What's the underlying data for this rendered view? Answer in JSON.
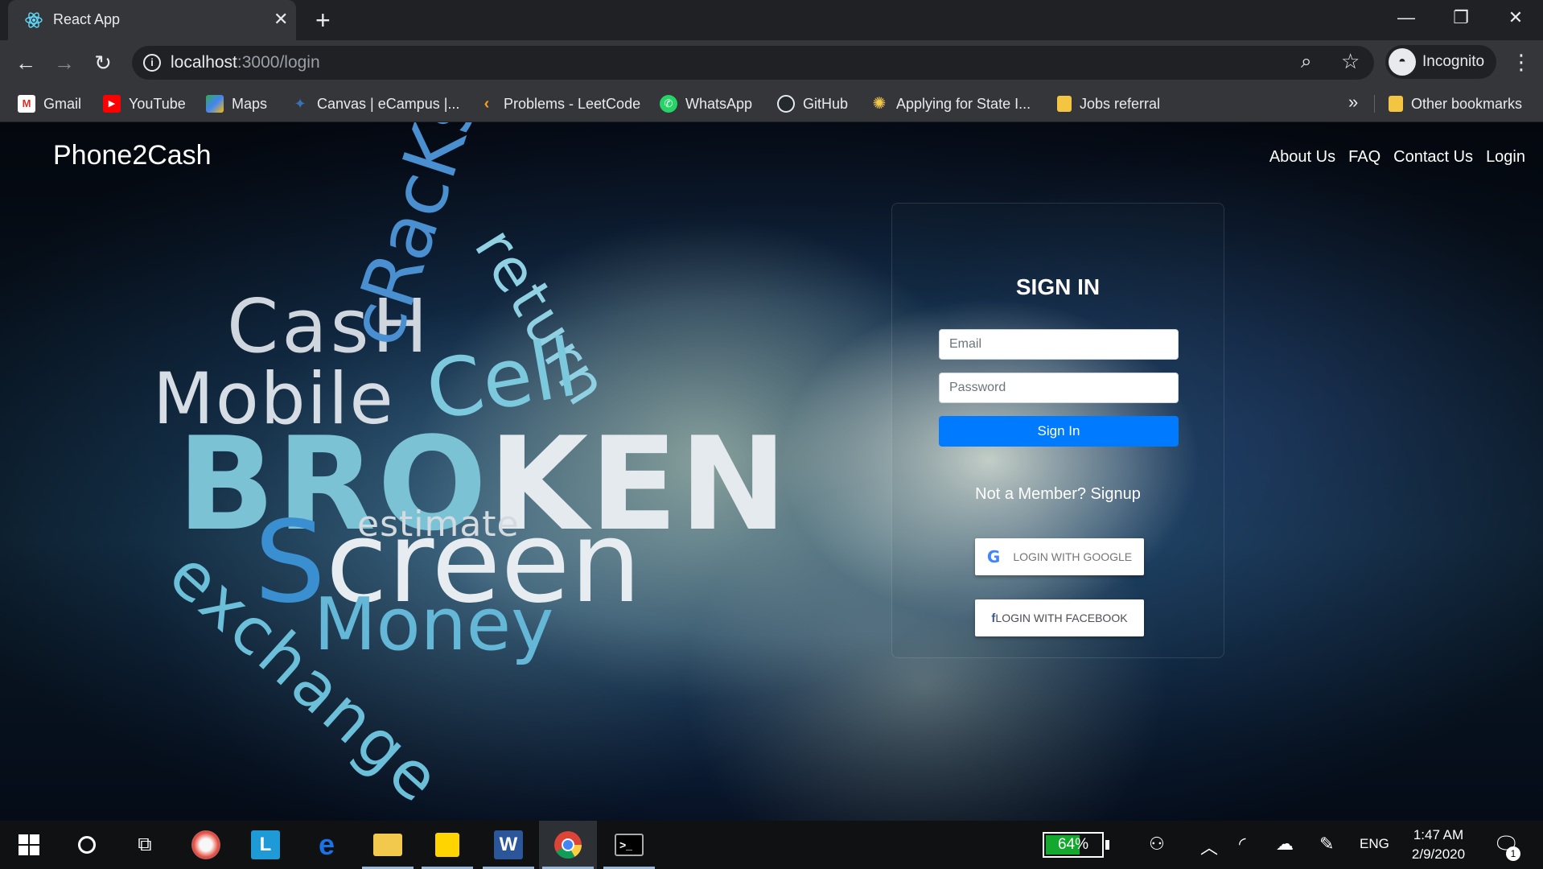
{
  "browser": {
    "tab_title": "React App",
    "tab_close": "✕",
    "new_tab": "+",
    "url_host": "localhost",
    "url_path": ":3000/login",
    "profile_label": "Incognito",
    "window_controls": {
      "minimize": "—",
      "maximize": "❐",
      "close": "✕"
    }
  },
  "bookmarks": [
    {
      "label": "Gmail",
      "icon": "gmail-icon",
      "color": "#d93025",
      "glyph": "M"
    },
    {
      "label": "YouTube",
      "icon": "youtube-icon",
      "color": "#ff0000",
      "glyph": "▶"
    },
    {
      "label": "Maps",
      "icon": "maps-icon",
      "color": "#34a853",
      "glyph": "◆"
    },
    {
      "label": "Canvas | eCampus |...",
      "icon": "canvas-icon",
      "color": "#3b6fb6",
      "glyph": "✦"
    },
    {
      "label": "Problems - LeetCode",
      "icon": "leetcode-icon",
      "color": "#f89f1b",
      "glyph": "‹"
    },
    {
      "label": "WhatsApp",
      "icon": "whatsapp-icon",
      "color": "#25d366",
      "glyph": "✆"
    },
    {
      "label": "GitHub",
      "icon": "github-icon",
      "color": "#24292e",
      "glyph": "●"
    },
    {
      "label": "Applying for State I...",
      "icon": "state-seal-icon",
      "color": "#c9a227",
      "glyph": "✺"
    },
    {
      "label": "Jobs referral",
      "icon": "folder-icon",
      "color": "#f4c542",
      "glyph": ""
    }
  ],
  "bookmarks_overflow": "»",
  "bookmarks_other": {
    "label": "Other bookmarks",
    "icon": "folder-icon",
    "color": "#f4c542"
  },
  "page": {
    "brand": "Phone2Cash",
    "nav": [
      "About Us",
      "FAQ",
      "Contact Us",
      "Login"
    ],
    "word_cloud": {
      "cash": "CasH",
      "mobile": "Mobile",
      "broken_a": "BRO",
      "broken_b": "KEN",
      "estimate": "estimate",
      "screen_a": "S",
      "screen_b": "creen",
      "money": "Money",
      "cell": "Cell",
      "cracks": "cRacKs",
      "return": "return",
      "exchange": "exchange"
    },
    "login": {
      "title": "SIGN IN",
      "email_placeholder": "Email",
      "password_placeholder": "Password",
      "signin_button": "Sign In",
      "signup_text": "Not a Member? Signup",
      "google_button": "LOGIN WITH GOOGLE",
      "facebook_icon": "f",
      "facebook_button": "LOGIN WITH FACEBOOK"
    }
  },
  "taskbar": {
    "battery_percent": 64,
    "battery_text": "64%",
    "language": "ENG",
    "time": "1:47 AM",
    "date": "2/9/2020",
    "notification_count": "1"
  },
  "colors": {
    "accent_button": "#007bff",
    "chrome_dark": "#202124",
    "chrome_toolbar": "#35363a"
  }
}
